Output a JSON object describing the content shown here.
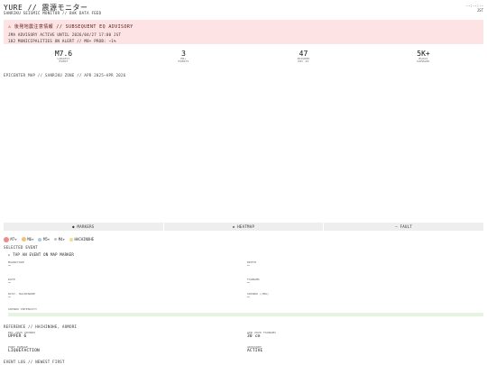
{
  "header": {
    "title": "YURE // 震源モニター",
    "subtitle": "SANRIKU SEISMIC MONITOR // BAK DATA FEED",
    "time": "--:--:--",
    "timezone": "JST"
  },
  "advisory": {
    "title": "⚠ 後発地震注意情報 // SUBSEQUENT EQ ADVISORY",
    "line1": "JMA ADVISORY ACTIVE UNTIL 2026/04/27 17:00 JST",
    "line2": "182 MUNICIPALITIES ON ALERT // M8+ PROB: ~1%"
  },
  "stats": [
    {
      "value": "M7.6",
      "label1": "LARGEST",
      "label2": "EVENT"
    },
    {
      "value": "3",
      "label1": "M6+",
      "label2": "EVENTS"
    },
    {
      "value": "47",
      "label1": "INJURED",
      "label2": "DEC 25"
    },
    {
      "value": "5K+",
      "label1": "BLDGS",
      "label2": "DAMAGED"
    }
  ],
  "map": {
    "caption": "EPICENTER MAP // SANRIKU ZONE // APR 2025–APR 2026",
    "tabs": [
      "● MARKERS",
      "◈ HEATMAP",
      "— FAULT"
    ]
  },
  "legend": [
    {
      "label": "M7+",
      "color": "#f08a8a",
      "size": 6
    },
    {
      "label": "M6+",
      "color": "#f2c078",
      "size": 5
    },
    {
      "label": "M5+",
      "color": "#a8cbe8",
      "size": 4
    },
    {
      "label": "M4+",
      "color": "#bfbfbf",
      "size": 3
    },
    {
      "label": "HACHINOHE",
      "color": "#f5dc8a",
      "size": 4
    }
  ],
  "selected": {
    "title": "SELECTED EVENT",
    "hint": "▸ TAP AN EVENT ON MAP MARKER",
    "magnitude_label": "MAGNITUDE",
    "magnitude_value": "—",
    "depth_label": "DEPTH",
    "depth_value": "—",
    "date_label": "DATE",
    "date_value": "—",
    "tsunami_label": "TSUNAMI",
    "tsunami_value": "—",
    "dist_label": "DIST. HACHINOHE",
    "dist_value": "—",
    "shindo_label": "SHINDO (JMA)",
    "shindo_value": "—",
    "intensity_label": "SHINDO INTENSITY"
  },
  "reference": {
    "title": "REFERENCE // HACHINOHE, AOMORI",
    "dec_label": "DEC 2025 SHINDO",
    "dec_value": "UPPER 6",
    "apr_label": "APR 2026 TSUNAMI",
    "apr_value": "30 cm",
    "port_label": "PORT DAMAGE",
    "port_value": "LIQUEFACTION",
    "advisory_label": "ADVISORY",
    "advisory_value": "ACTIVE"
  },
  "event_log": {
    "title": "EVENT LOG // NEWEST FIRST"
  }
}
